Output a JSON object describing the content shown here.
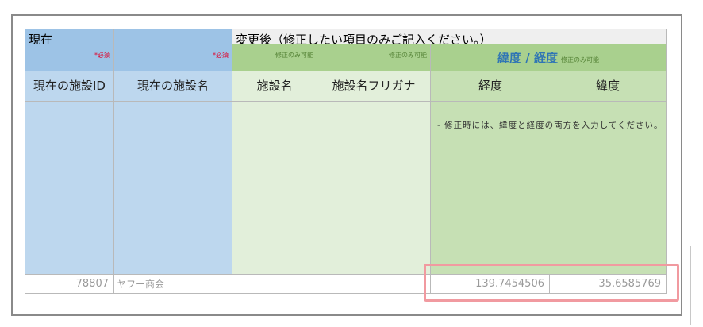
{
  "row1": {
    "current": "現在",
    "change_heading": "変更後（修正したい項目のみご記入ください。）"
  },
  "row2": {
    "required": "*必須",
    "required2": "*必須",
    "modifiable": "修正のみ可能",
    "modifiable2": "修正のみ可能",
    "latlon_title": "緯度 / 経度",
    "latlon_mod": "修正のみ可能"
  },
  "headers": {
    "current_id": "現在の施設ID",
    "current_name": "現在の施設名",
    "facility_name": "施設名",
    "facility_kana": "施設名フリガナ",
    "longitude": "経度",
    "latitude": "緯度"
  },
  "note": "- 修正時には、緯度と経度の両方を入力してください。",
  "data_row": {
    "id": "78807",
    "name": "ヤフー商会",
    "facility_name": "",
    "facility_kana": "",
    "longitude": "139.7454506",
    "latitude": "35.6585769"
  },
  "colors": {
    "highlight_box": "#f19aa0",
    "latlon_title": "#2f75b5",
    "required": "#e0002a"
  }
}
